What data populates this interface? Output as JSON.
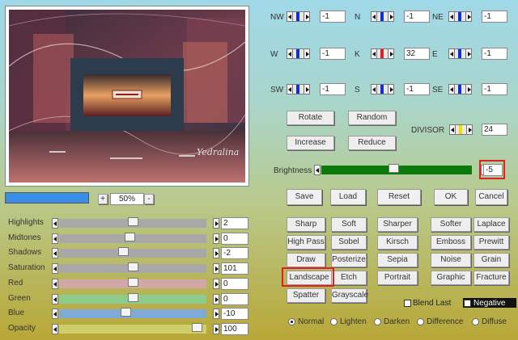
{
  "preview": {
    "watermark": "Yedralina"
  },
  "zoom": {
    "plus": "+",
    "value": "50%",
    "minus": "-"
  },
  "adjust": [
    {
      "label": "Highlights",
      "value": "2",
      "fraction": 0.5,
      "color": "#a8a8a8"
    },
    {
      "label": "Midtones",
      "value": "0",
      "fraction": 0.48,
      "color": "#a8a8a8"
    },
    {
      "label": "Shadows",
      "value": "-2",
      "fraction": 0.43,
      "color": "#a8a8a8"
    },
    {
      "label": "Saturation",
      "value": "101",
      "fraction": 0.5,
      "color": "#a8a8a8"
    },
    {
      "label": "Red",
      "value": "0",
      "fraction": 0.5,
      "color": "#d2a7a7"
    },
    {
      "label": "Green",
      "value": "0",
      "fraction": 0.5,
      "color": "#8ccd8c"
    },
    {
      "label": "Blue",
      "value": "-10",
      "fraction": 0.45,
      "color": "#7fa9d6"
    },
    {
      "label": "Opacity",
      "value": "100",
      "fraction": 0.97,
      "color": "#cece6a"
    }
  ],
  "matrix": [
    {
      "label": "NW",
      "value": "-1",
      "marker": "#1030d0"
    },
    {
      "label": "N",
      "value": "-1",
      "marker": "#1030d0"
    },
    {
      "label": "NE",
      "value": "-1",
      "marker": "#1030d0"
    },
    {
      "label": "W",
      "value": "-1",
      "marker": "#1030d0"
    },
    {
      "label": "K",
      "value": "32",
      "marker": "#e02020"
    },
    {
      "label": "E",
      "value": "-1",
      "marker": "#1030d0"
    },
    {
      "label": "SW",
      "value": "-1",
      "marker": "#1030d0"
    },
    {
      "label": "S",
      "value": "-1",
      "marker": "#1030d0"
    },
    {
      "label": "SE",
      "value": "-1",
      "marker": "#1030d0"
    }
  ],
  "buttons": {
    "rotate": "Rotate",
    "random": "Random",
    "increase": "Increase",
    "reduce": "Reduce"
  },
  "divisor": {
    "label": "DIVISOR",
    "value": "24",
    "marker": "#f0e000"
  },
  "brightness": {
    "label": "Brightness",
    "value": "-5",
    "fraction": 0.48,
    "color": "#0a7a0a"
  },
  "actions": {
    "save": "Save",
    "load": "Load",
    "reset": "Reset",
    "ok": "OK",
    "cancel": "Cancel"
  },
  "presets": [
    "Sharp",
    "Soft",
    "Sharper",
    "Softer",
    "Laplace",
    "High Pass",
    "Sobel",
    "Kirsch",
    "Emboss",
    "Prewitt",
    "Draw",
    "Posterize",
    "Sepia",
    "Noise",
    "Grain",
    "Landscape",
    "Etch",
    "Portrait",
    "Graphic",
    "Fracture",
    "Spatter",
    "Grayscale"
  ],
  "selected_preset": "Landscape",
  "checks": {
    "blend_last": "Blend Last",
    "negative": "Negative"
  },
  "modes": [
    "Normal",
    "Lighten",
    "Darken",
    "Difference",
    "Diffuse"
  ],
  "selected_mode": "Normal",
  "colors": {
    "progress": "#3a8ee8",
    "highlight": "#e0201c"
  }
}
